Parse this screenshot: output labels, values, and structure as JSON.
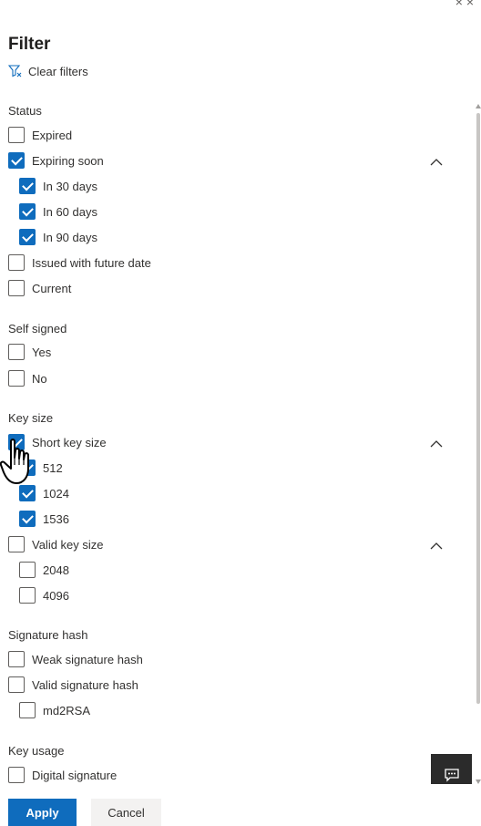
{
  "panel": {
    "close_glyph": "× ×",
    "title": "Filter",
    "clear_filters": "Clear filters"
  },
  "sections": {
    "status": {
      "title": "Status",
      "expired": "Expired",
      "expiring_soon": "Expiring soon",
      "in30": "In 30 days",
      "in60": "In 60 days",
      "in90": "In 90 days",
      "future": "Issued with future date",
      "current": "Current"
    },
    "self_signed": {
      "title": "Self signed",
      "yes": "Yes",
      "no": "No"
    },
    "key_size": {
      "title": "Key size",
      "short": "Short key size",
      "k512": "512",
      "k1024": "1024",
      "k1536": "1536",
      "valid": "Valid key size",
      "k2048": "2048",
      "k4096": "4096"
    },
    "signature_hash": {
      "title": "Signature hash",
      "weak": "Weak signature hash",
      "valid": "Valid signature hash",
      "md2rsa": "md2RSA"
    },
    "key_usage": {
      "title": "Key usage",
      "digital": "Digital signature"
    }
  },
  "checked": {
    "expiring_soon": true,
    "in30": true,
    "in60": true,
    "in90": true,
    "short": true,
    "k512": true,
    "k1024": true,
    "k1536": true
  },
  "footer": {
    "apply": "Apply",
    "cancel": "Cancel"
  },
  "colors": {
    "accent": "#0f6cbd",
    "feedback_bg": "#2b2b2b"
  }
}
